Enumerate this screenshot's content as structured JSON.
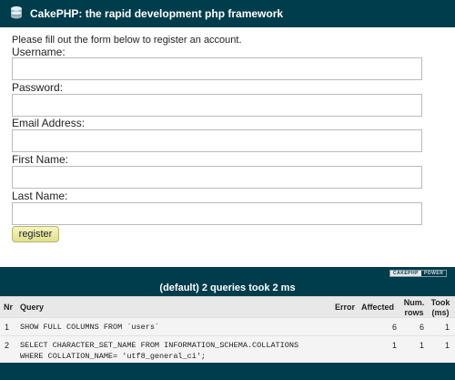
{
  "header": {
    "title": "CakePHP: the rapid development php framework",
    "logo_icon": "cakephp-logo-icon"
  },
  "form": {
    "intro": "Please fill out the form below to register an account.",
    "fields": [
      {
        "label": "Username:",
        "value": ""
      },
      {
        "label": "Password:",
        "value": ""
      },
      {
        "label": "Email Address:",
        "value": ""
      },
      {
        "label": "First Name:",
        "value": ""
      },
      {
        "label": "Last Name:",
        "value": ""
      }
    ],
    "submit_label": "register"
  },
  "powered_badge": {
    "part1": "CAKEPHP",
    "part2": "POWER"
  },
  "sql_log": {
    "caption": "(default) 2 queries took 2 ms",
    "headers": {
      "nr": "Nr",
      "query": "Query",
      "error": "Error",
      "affected": "Affected",
      "num_rows_1": "Num.",
      "num_rows_2": "rows",
      "took_1": "Took",
      "took_2": "(ms)"
    },
    "rows": [
      {
        "nr": "1",
        "query_lines": [
          "SHOW FULL COLUMNS FROM `users`"
        ],
        "error": "",
        "affected": "6",
        "num_rows": "6",
        "took": "1"
      },
      {
        "nr": "2",
        "query_lines": [
          "SELECT CHARACTER_SET_NAME FROM INFORMATION_SCHEMA.COLLATIONS",
          "WHERE COLLATION_NAME= 'utf8_general_ci';"
        ],
        "error": "",
        "affected": "1",
        "num_rows": "1",
        "took": "1"
      }
    ]
  },
  "colors": {
    "header_bg": "#003d4c",
    "button_bg": "#e8e8a8"
  }
}
